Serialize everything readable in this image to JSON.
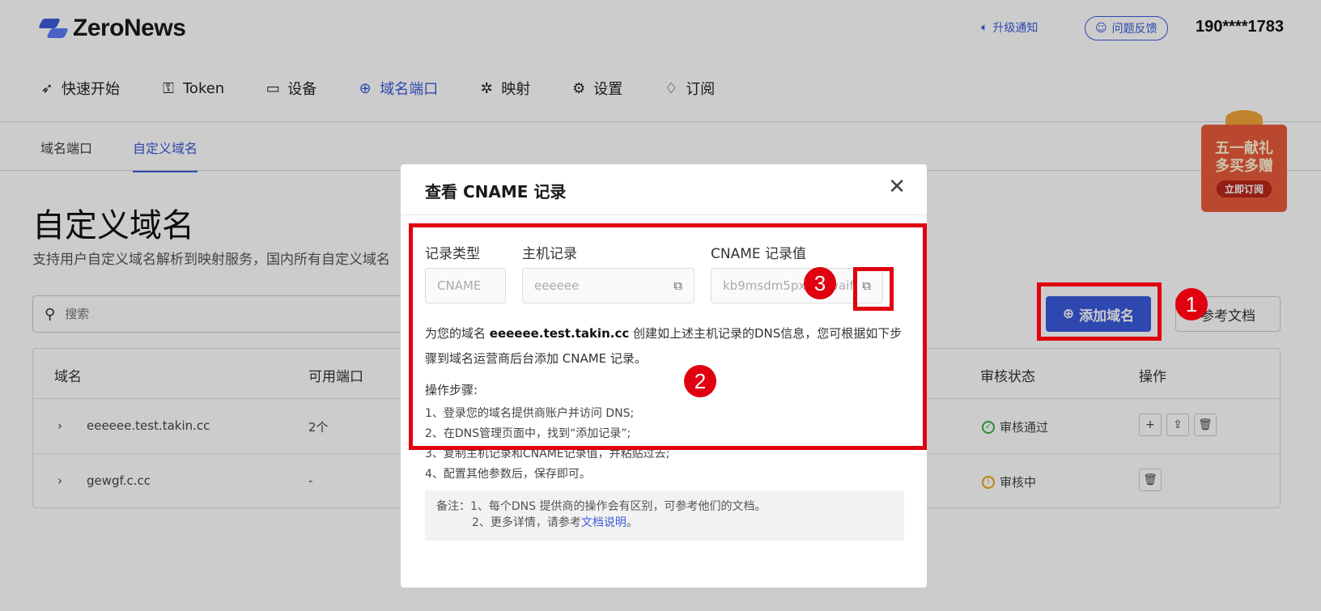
{
  "app": {
    "logo_text": "ZeroNews",
    "upgrade_notice": "升级通知",
    "feedback": "问题反馈",
    "user_phone": "190****1783"
  },
  "nav": {
    "items": [
      {
        "label": "快速开始",
        "icon": "rocket-icon"
      },
      {
        "label": "Token",
        "icon": "key-icon"
      },
      {
        "label": "设备",
        "icon": "laptop-icon"
      },
      {
        "label": "域名端口",
        "icon": "globe-icon"
      },
      {
        "label": "映射",
        "icon": "network-icon"
      },
      {
        "label": "设置",
        "icon": "gear-icon"
      },
      {
        "label": "订阅",
        "icon": "diamond-icon"
      }
    ],
    "active": "域名端口"
  },
  "subnav": {
    "items": [
      "域名端口",
      "自定义域名"
    ],
    "active": "自定义域名"
  },
  "page": {
    "title": "自定义域名",
    "description": "支持用户自定义域名解析到映射服务，国内所有自定义域名",
    "search_placeholder": "搜索",
    "add_button": "添加域名",
    "doc_button": "参考文档"
  },
  "table": {
    "headers": [
      "域名",
      "可用端口",
      "审核状态",
      "操作"
    ],
    "rows": [
      {
        "domain": "eeeeee.test.takin.cc",
        "ports": "2个",
        "status": "审核通过",
        "status_type": "ok"
      },
      {
        "domain": "gewgf.c.cc",
        "ports": "-",
        "status": "审核中",
        "status_type": "pending"
      }
    ]
  },
  "promo": {
    "line1": "五一献礼",
    "line2": "多买多赠",
    "cta": "立即订阅"
  },
  "modal": {
    "title": "查看 CNAME 记录",
    "labels": {
      "record_type": "记录类型",
      "host_record": "主机记录",
      "cname_value": "CNAME 记录值"
    },
    "values": {
      "record_type": "CNAME",
      "host_record": "eeeeee",
      "cname_value": "kb9msdm5px.c  t.waif"
    },
    "info_prefix": "为您的域名 ",
    "info_domain": "eeeeee.test.takin.cc",
    "info_suffix": " 创建如上述主机记录的DNS信息，您可根据如下步骤到域名运营商后台添加 CNAME 记录。",
    "steps_heading": "操作步骤:",
    "steps": [
      "1、登录您的域名提供商账户并访问 DNS;",
      "2、在DNS管理页面中，找到“添加记录”;",
      "3、复制主机记录和CNAME记录值，并粘贴过去;",
      "4、配置其他参数后，保存即可。"
    ],
    "note_line1": "备注：1、每个DNS 提供商的操作会有区别，可参考他们的文档。",
    "note_line2_prefix": "2、更多详情，请参考",
    "note_link": "文档说明",
    "note_line2_suffix": "。"
  },
  "annotations": {
    "badge1": "1",
    "badge2": "2",
    "badge3": "3"
  },
  "colors": {
    "accent": "#3b5bdb",
    "annotation": "#e0000f",
    "ok": "#2fb344",
    "warn": "#e8a317"
  }
}
